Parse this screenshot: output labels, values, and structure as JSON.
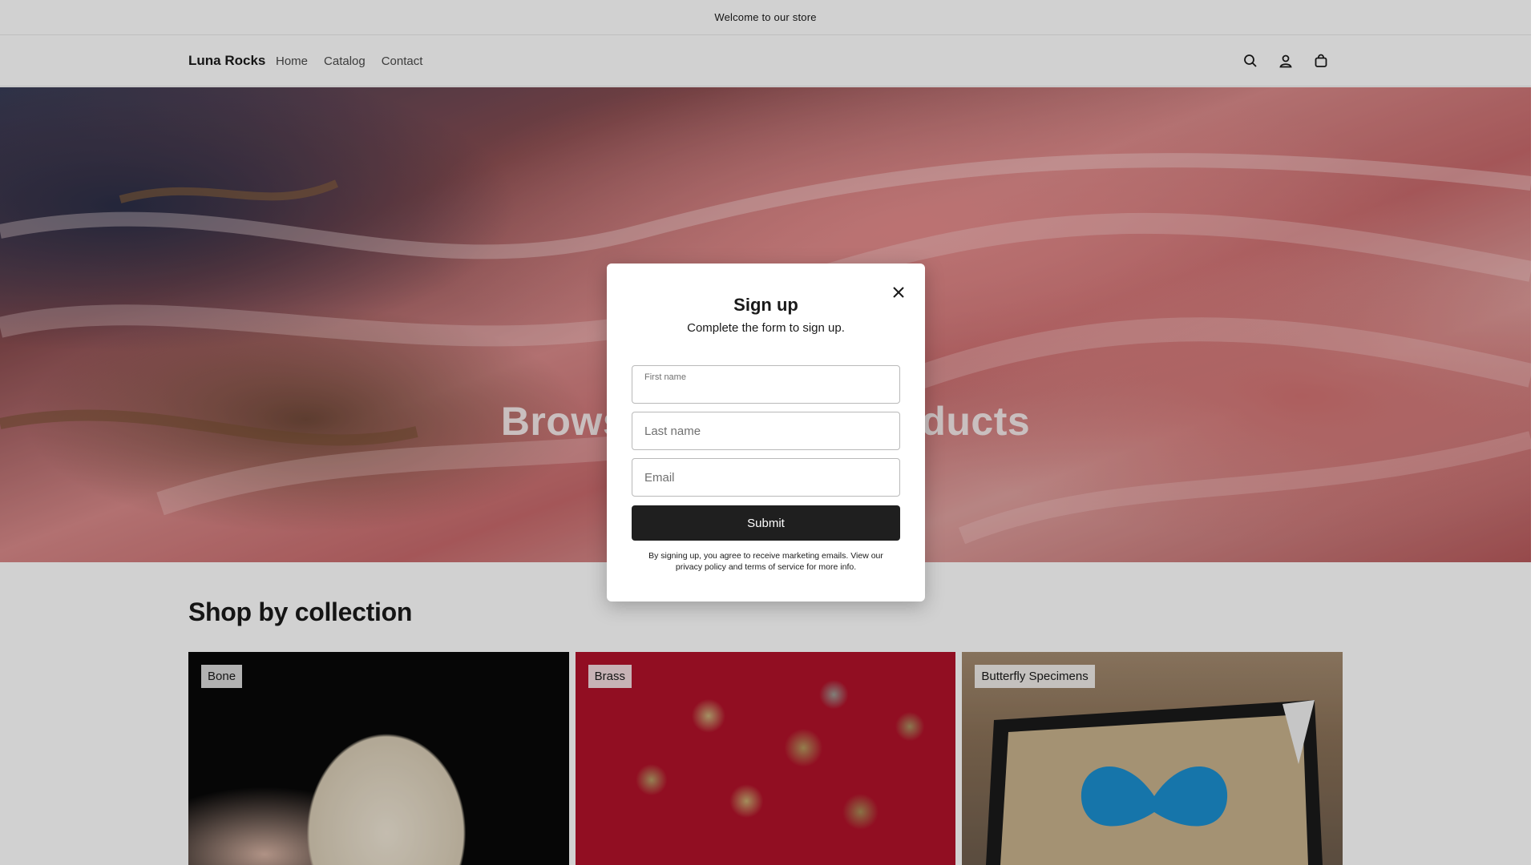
{
  "announcement": {
    "text": "Welcome to our store"
  },
  "header": {
    "logo": "Luna Rocks",
    "nav": [
      {
        "label": "Home"
      },
      {
        "label": "Catalog"
      },
      {
        "label": "Contact"
      }
    ],
    "icons": [
      "search-icon",
      "account-icon",
      "cart-icon"
    ]
  },
  "hero": {
    "heading": "Browse our latest products"
  },
  "collections": {
    "title": "Shop by collection",
    "items": [
      {
        "label": "Bone"
      },
      {
        "label": "Brass"
      },
      {
        "label": "Butterfly Specimens"
      }
    ]
  },
  "modal": {
    "title": "Sign up",
    "subtitle": "Complete the form to sign up.",
    "fields": {
      "first_name_label": "First name",
      "last_name_placeholder": "Last name",
      "email_placeholder": "Email"
    },
    "submit_label": "Submit",
    "legal": "By signing up, you agree to receive marketing emails. View our privacy policy and terms of service for more info."
  },
  "colors": {
    "button": "#1f1f1f",
    "text": "#1a1a1a",
    "brass_background": "#b1122a"
  }
}
